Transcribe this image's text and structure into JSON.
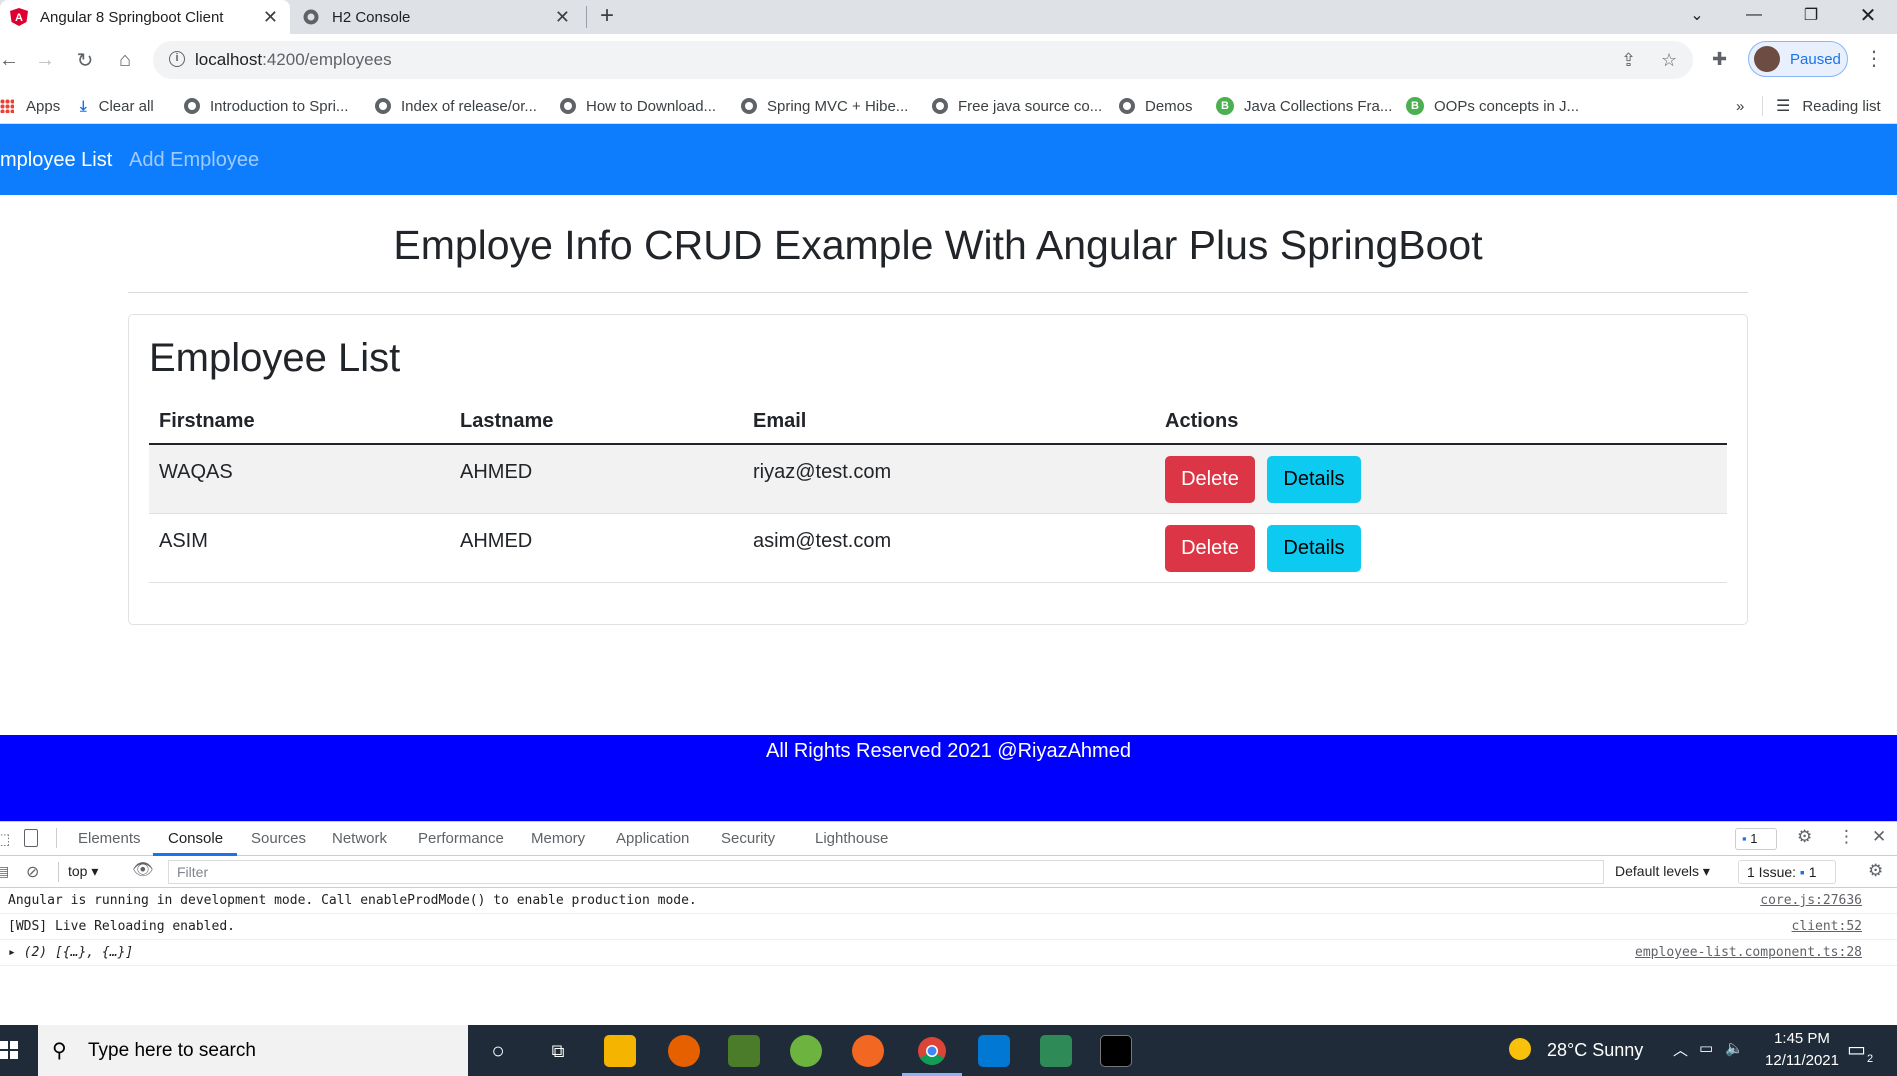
{
  "browser": {
    "tabs": [
      {
        "title": "Angular 8 Springboot Client",
        "favicon": "angular-icon"
      },
      {
        "title": "H2 Console",
        "favicon": "globe-icon"
      }
    ],
    "url_host": "localhost",
    "url_path": ":4200/employees",
    "profile_label": "Paused",
    "bookmarks": [
      {
        "label": "Apps",
        "icon": "apps-grid-icon"
      },
      {
        "label": "Clear all",
        "icon": "download-icon"
      },
      {
        "label": "Introduction to Spri...",
        "icon": "globe-icon"
      },
      {
        "label": "Index of release/or...",
        "icon": "globe-icon"
      },
      {
        "label": "How to Download...",
        "icon": "globe-icon"
      },
      {
        "label": "Spring MVC + Hibe...",
        "icon": "globe-icon"
      },
      {
        "label": "Free java source co...",
        "icon": "globe-icon"
      },
      {
        "label": "Demos",
        "icon": "globe-icon"
      },
      {
        "label": "Java Collections Fra...",
        "icon": "b-icon"
      },
      {
        "label": "OOPs concepts in J...",
        "icon": "b-icon"
      }
    ],
    "bookmarks_overflow": "»",
    "reading_list": "Reading list"
  },
  "app": {
    "nav": {
      "employee_list": "mployee List",
      "add_employee": "Add Employee"
    },
    "title": "Employe Info CRUD Example With Angular Plus SpringBoot",
    "card_title": "Employee List",
    "table": {
      "headers": [
        "Firstname",
        "Lastname",
        "Email",
        "Actions"
      ],
      "rows": [
        {
          "firstname": "WAQAS",
          "lastname": "AHMED",
          "email": "riyaz@test.com"
        },
        {
          "firstname": "ASIM",
          "lastname": "AHMED",
          "email": "asim@test.com"
        }
      ],
      "delete_label": "Delete",
      "details_label": "Details"
    },
    "footer": "All Rights Reserved 2021 @RiyazAhmed",
    "colors": {
      "nav": "#0d7dfd",
      "footer": "#0000fe",
      "delete": "#dc3545",
      "details": "#0dcaf0"
    }
  },
  "devtools": {
    "tabs": [
      "Elements",
      "Console",
      "Sources",
      "Network",
      "Performance",
      "Memory",
      "Application",
      "Security",
      "Lighthouse"
    ],
    "active_tab": "Console",
    "message_badge": "1",
    "context": "top",
    "filter_placeholder": "Filter",
    "levels": "Default levels",
    "issues": "1 Issue:",
    "issues_count": "1",
    "logs": [
      {
        "message": "Angular is running in development mode. Call enableProdMode() to enable production mode.",
        "source": "core.js:27636"
      },
      {
        "message": "[WDS] Live Reloading enabled.",
        "source": "client:52"
      },
      {
        "message": "(2) [{…}, {…}]",
        "source": "employee-list.component.ts:28"
      }
    ]
  },
  "taskbar": {
    "search_placeholder": "Type here to search",
    "weather": "28°C  Sunny",
    "time": "1:45 PM",
    "date": "12/11/2021",
    "notifications": "2"
  }
}
